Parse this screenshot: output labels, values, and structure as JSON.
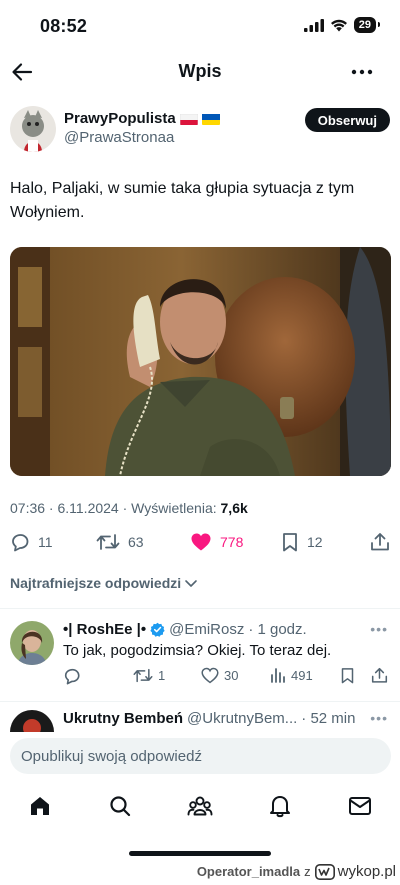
{
  "status_bar": {
    "time": "08:52",
    "battery": "29"
  },
  "nav": {
    "title": "Wpis"
  },
  "post": {
    "display_name": "PrawyPopulista",
    "flags": [
      "poland-flag",
      "ukraine-flag"
    ],
    "handle": "@PrawaStronaa",
    "follow_label": "Obserwuj",
    "text": "Halo, Paljaki, w sumie taka głupia sytuacja z tym Wołyniem.",
    "timestamp": "07:36 · 6.11.2024 · Wyświetlenia: ",
    "views": "7,6k",
    "stats": {
      "replies": "11",
      "reposts": "63",
      "likes": "778",
      "bookmarks": "12"
    }
  },
  "replies_sort_label": "Najtrafniejsze odpowiedzi",
  "replies": [
    {
      "name": "•| RoshEe |•",
      "verified": true,
      "handle": "@EmiRosz",
      "time": "· 1 godz.",
      "text": "To jak, pogodzimsia? Okiej. To teraz dej.",
      "reply_count": "",
      "reposts": "1",
      "likes": "30",
      "views": "491"
    },
    {
      "name": "Ukrutny Bembeń",
      "handle": "@UkrutnyBem...",
      "time": "· 52 min"
    }
  ],
  "composer": {
    "placeholder": "Opublikuj swoją odpowiedź"
  },
  "tab_bar": {
    "tabs": [
      "home-icon",
      "search-icon",
      "communities-icon",
      "notifications-icon",
      "messages-icon"
    ]
  },
  "watermark": {
    "user": "Operator_imadla",
    "z": "z",
    "site": "wykop.pl"
  },
  "colors": {
    "like_pink": "#f91880",
    "text": "#0f1419",
    "secondary": "#536471",
    "verified_blue": "#1d9bf0"
  }
}
